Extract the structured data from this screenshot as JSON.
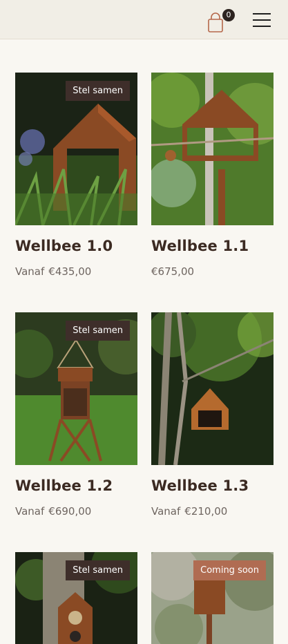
{
  "header": {
    "cart_count": "0",
    "cart_icon": "shopping-bag-icon",
    "menu_icon": "hamburger-menu-icon"
  },
  "products": [
    {
      "title": "Wellbee 1.0",
      "price_prefix": "Vanaf",
      "price": "€435,00",
      "badge": "Stel samen"
    },
    {
      "title": "Wellbee 1.1",
      "price_prefix": "",
      "price": "€675,00",
      "badge": ""
    },
    {
      "title": "Wellbee 1.2",
      "price_prefix": "Vanaf",
      "price": "€690,00",
      "badge": "Stel samen"
    },
    {
      "title": "Wellbee 1.3",
      "price_prefix": "Vanaf",
      "price": "€210,00",
      "badge": ""
    },
    {
      "title": "",
      "price_prefix": "",
      "price": "",
      "badge": "Stel samen"
    },
    {
      "title": "",
      "price_prefix": "",
      "price": "",
      "badge": "Coming soon"
    }
  ],
  "colors": {
    "background": "#f9f7f2",
    "header_bg": "#f1eee6",
    "badge_dark": "#3e2e2a",
    "badge_soon": "#b06c52",
    "title": "#3b2a22",
    "corten": "#8a4a24"
  }
}
